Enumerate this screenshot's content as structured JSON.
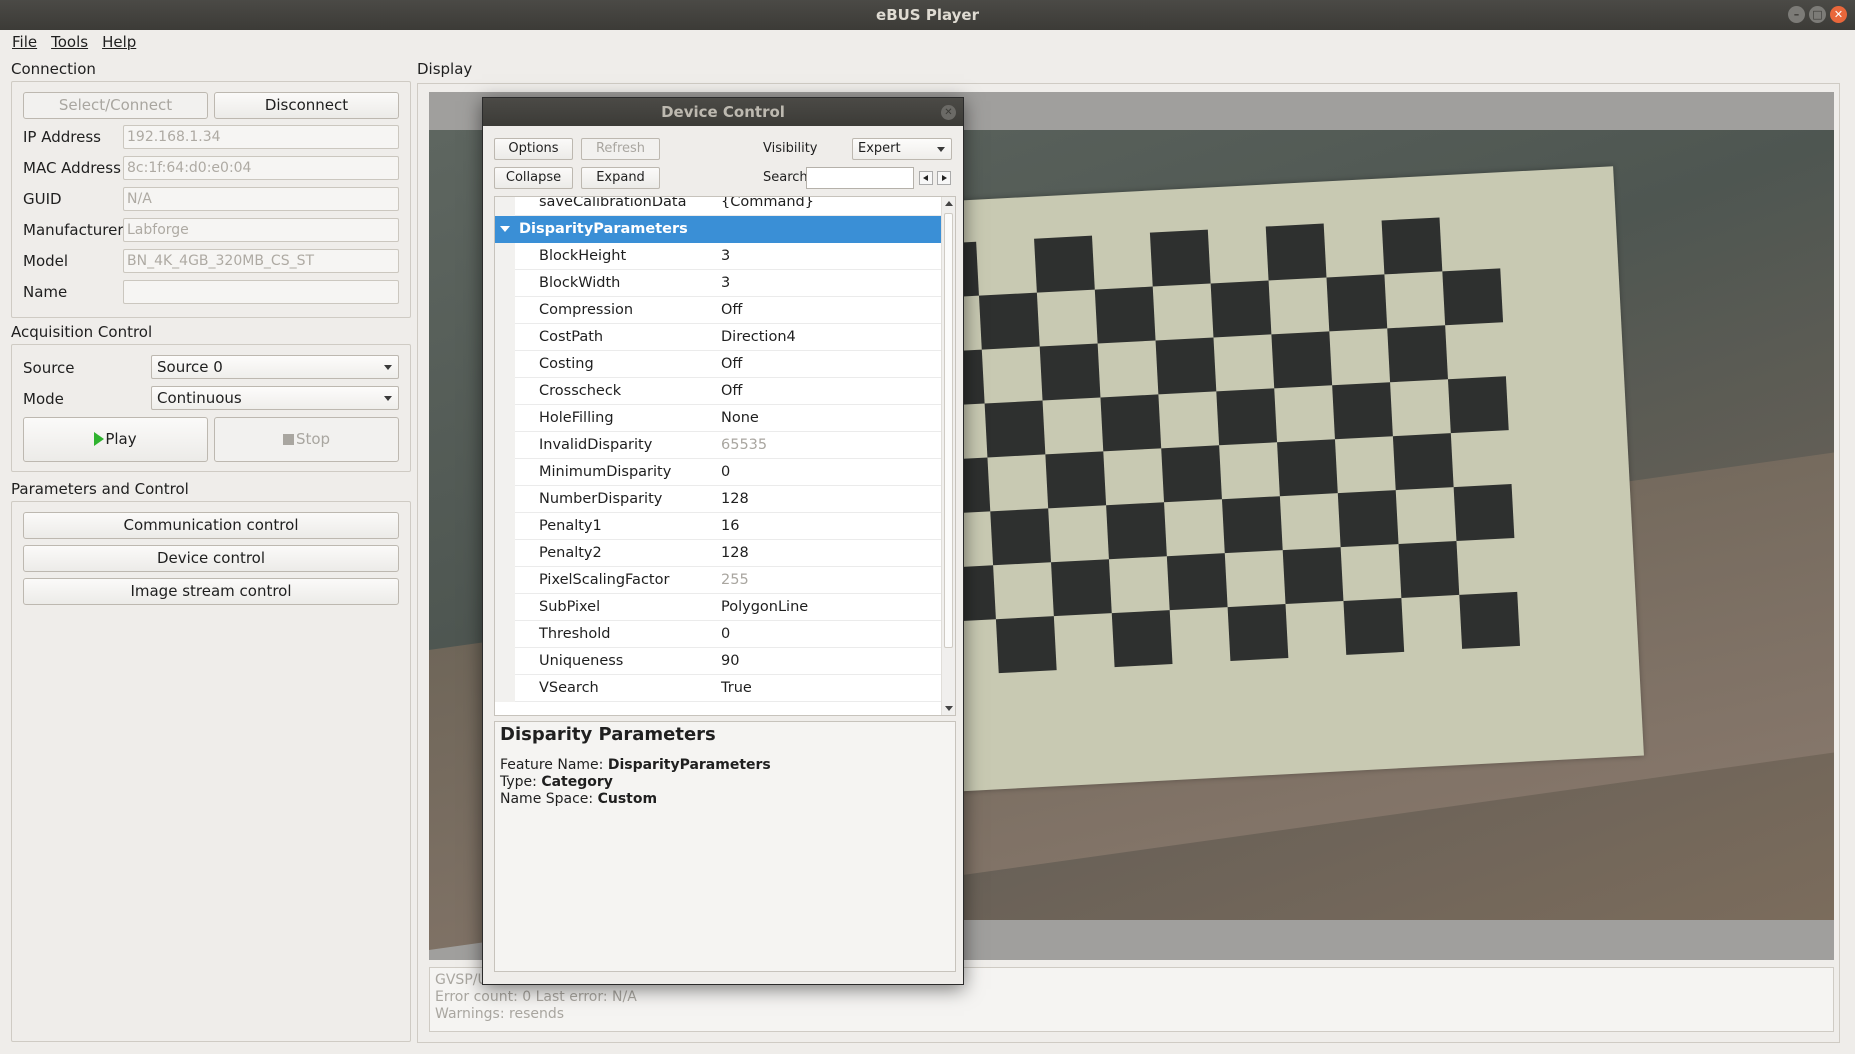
{
  "window": {
    "title": "eBUS Player"
  },
  "menu": [
    "File",
    "Tools",
    "Help"
  ],
  "connection": {
    "title": "Connection",
    "select_label": "Select/Connect",
    "disconnect_label": "Disconnect",
    "fields": [
      {
        "label": "IP Address",
        "value": "192.168.1.34"
      },
      {
        "label": "MAC Address",
        "value": "8c:1f:64:d0:e0:04"
      },
      {
        "label": "GUID",
        "value": "N/A"
      },
      {
        "label": "Manufacturer",
        "value": "Labforge"
      },
      {
        "label": "Model",
        "value": "BN_4K_4GB_320MB_CS_ST"
      },
      {
        "label": "Name",
        "value": ""
      }
    ]
  },
  "acquisition": {
    "title": "Acquisition Control",
    "source_label": "Source",
    "source_value": "Source 0",
    "mode_label": "Mode",
    "mode_value": "Continuous",
    "play_label": "Play",
    "stop_label": "Stop"
  },
  "parameters": {
    "title": "Parameters and Control",
    "buttons": [
      "Communication control",
      "Device control",
      "Image stream control"
    ]
  },
  "display": {
    "title": "Display",
    "status_lines": [
      "GVSP/U",
      "Error count: 0    Last error: N/A",
      "Warnings: resends"
    ]
  },
  "device_control": {
    "title": "Device Control",
    "options_label": "Options",
    "refresh_label": "Refresh",
    "collapse_label": "Collapse",
    "expand_label": "Expand",
    "visibility_label": "Visibility",
    "visibility_value": "Expert",
    "search_label": "Search",
    "search_value": "",
    "rows": [
      {
        "name": "saveCalibrationData",
        "value": "{Command}"
      },
      {
        "name": "DisparityParameters",
        "value": "",
        "category": true
      },
      {
        "name": "BlockHeight",
        "value": "3"
      },
      {
        "name": "BlockWidth",
        "value": "3"
      },
      {
        "name": "Compression",
        "value": "Off"
      },
      {
        "name": "CostPath",
        "value": "Direction4"
      },
      {
        "name": "Costing",
        "value": "Off"
      },
      {
        "name": "Crosscheck",
        "value": "Off"
      },
      {
        "name": "HoleFilling",
        "value": "None"
      },
      {
        "name": "InvalidDisparity",
        "value": "65535",
        "readonly": true
      },
      {
        "name": "MinimumDisparity",
        "value": "0"
      },
      {
        "name": "NumberDisparity",
        "value": "128"
      },
      {
        "name": "Penalty1",
        "value": "16"
      },
      {
        "name": "Penalty2",
        "value": "128"
      },
      {
        "name": "PixelScalingFactor",
        "value": "255",
        "readonly": true
      },
      {
        "name": "SubPixel",
        "value": "PolygonLine"
      },
      {
        "name": "Threshold",
        "value": "0"
      },
      {
        "name": "Uniqueness",
        "value": "90"
      },
      {
        "name": "VSearch",
        "value": "True"
      }
    ],
    "description": {
      "heading": "Disparity Parameters",
      "feature_name_label": "Feature Name:",
      "feature_name": "DisparityParameters",
      "type_label": "Type:",
      "type": "Category",
      "namespace_label": "Name Space:",
      "namespace": "Custom"
    }
  },
  "colors": {
    "selection": "#3a8fd6",
    "titlebar": "#3c3b37",
    "close": "#e9673b",
    "play": "#2fb32f"
  }
}
